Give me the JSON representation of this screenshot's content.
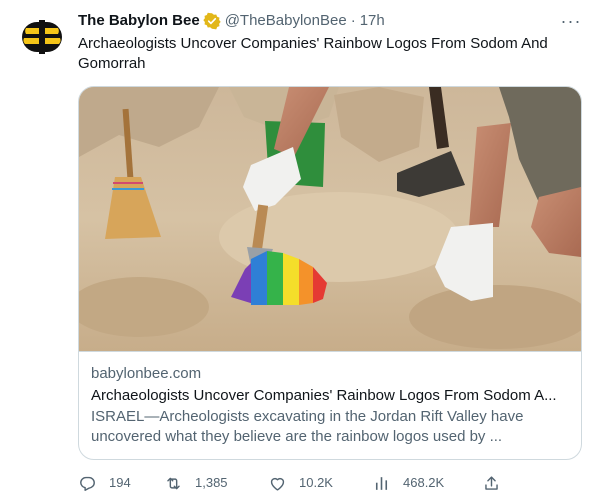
{
  "tweet": {
    "author_name": "The Babylon Bee",
    "handle": "@TheBabylonBee",
    "separator": "·",
    "time": "17h",
    "text": "Archaeologists Uncover Companies' Rainbow Logos From Sodom And Gomorrah"
  },
  "card": {
    "domain": "babylonbee.com",
    "title": "Archaeologists Uncover Companies' Rainbow Logos From Sodom A...",
    "description": "ISRAEL—Archeologists excavating in the Jordan Rift Valley have uncovered what they believe are the rainbow logos used by ..."
  },
  "actions": {
    "replies": "194",
    "retweets": "1,385",
    "likes": "10.2K",
    "views": "468.2K"
  },
  "icons": {
    "avatar": "bee-logo-icon",
    "verified": "verified-badge-icon",
    "more": "more-options-icon",
    "reply": "reply-icon",
    "retweet": "retweet-icon",
    "like": "heart-icon",
    "views": "views-chart-icon",
    "share": "share-icon"
  },
  "colors": {
    "text": "#0f1419",
    "secondary_text": "#536471",
    "border": "#cfd9de",
    "verified_gold": "#e2b719",
    "bee_black": "#111111",
    "bee_yellow": "#f5c518"
  }
}
